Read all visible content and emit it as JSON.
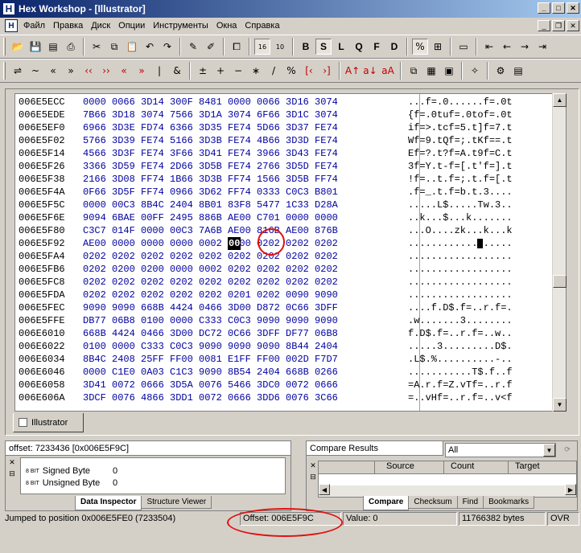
{
  "window": {
    "title": "Hex Workshop - [Illustrator]"
  },
  "menu": [
    "Файл",
    "Правка",
    "Диск",
    "Опции",
    "Инструменты",
    "Окна",
    "Справка"
  ],
  "toolbar1": {
    "mode_labels": [
      "B",
      "S",
      "L",
      "Q",
      "F",
      "D"
    ]
  },
  "hex_rows": [
    {
      "addr": "006E5ECC",
      "hex": "0000 0066 3D14 300F 8481 0000 0066 3D16 3074",
      "ascii": "...f=.0......f=.0t"
    },
    {
      "addr": "006E5EDE",
      "hex": "7B66 3D18 3074 7566 3D1A 3074 6F66 3D1C 3074",
      "ascii": "{f=.0tuf=.0tof=.0t"
    },
    {
      "addr": "006E5EF0",
      "hex": "6966 3D3E FD74 6366 3D35 FE74 5D66 3D37 FE74",
      "ascii": "if=>.tcf=5.t]f=7.t"
    },
    {
      "addr": "006E5F02",
      "hex": "5766 3D39 FE74 5166 3D3B FE74 4B66 3D3D FE74",
      "ascii": "Wf=9.tQf=;.tKf==.t"
    },
    {
      "addr": "006E5F14",
      "hex": "4566 3D3F FE74 3F66 3D41 FE74 3966 3D43 FE74",
      "ascii": "Ef=?.t?f=A.t9f=C.t"
    },
    {
      "addr": "006E5F26",
      "hex": "3366 3D59 FE74 2D66 3D5B FE74 2766 3D5D FE74",
      "ascii": "3f=Y.t-f=[.t'f=].t"
    },
    {
      "addr": "006E5F38",
      "hex": "2166 3D08 FF74 1B66 3D3B FF74 1566 3D5B FF74",
      "ascii": "!f=..t.f=;.t.f=[.t"
    },
    {
      "addr": "006E5F4A",
      "hex": "0F66 3D5F FF74 0966 3D62 FF74 0333 C0C3 B801",
      "ascii": ".f=_.t.f=b.t.3...."
    },
    {
      "addr": "006E5F5C",
      "hex": "0000 00C3 8B4C 2404 8B01 83F8 5477 1C33 D28A",
      "ascii": ".....L$.....Tw.3.."
    },
    {
      "addr": "006E5F6E",
      "hex": "9094 6BAE 00FF 2495 886B AE00 C701 0000 0000",
      "ascii": "..k...$...k......."
    },
    {
      "addr": "006E5F80",
      "hex": "C3C7 014F 0000 00C3 7A6B AE00 816B AE00 876B",
      "ascii": "...O....zk...k...k"
    },
    {
      "addr": "006E5F92",
      "hex": "AE00 0000 0000 0000 0002 0000 0202 0202 0202",
      "ascii": ".................."
    },
    {
      "addr": "006E5FA4",
      "hex": "0202 0202 0202 0202 0202 0202 0202 0202 0202",
      "ascii": ".................."
    },
    {
      "addr": "006E5FB6",
      "hex": "0202 0200 0200 0000 0002 0202 0202 0202 0202",
      "ascii": ".................."
    },
    {
      "addr": "006E5FC8",
      "hex": "0202 0202 0202 0202 0202 0202 0202 0202 0202",
      "ascii": ".................."
    },
    {
      "addr": "006E5FDA",
      "hex": "0202 0202 0202 0202 0202 0201 0202 0090 9090",
      "ascii": ".................."
    },
    {
      "addr": "006E5FEC",
      "hex": "9090 9090 668B 4424 0466 3D00 D872 0C66 3DFF",
      "ascii": "....f.D$.f=..r.f=."
    },
    {
      "addr": "006E5FFE",
      "hex": "DB77 06B8 0100 0000 C333 C0C3 9090 9090 9090",
      "ascii": ".w.......3........"
    },
    {
      "addr": "006E6010",
      "hex": "668B 4424 0466 3D00 DC72 0C66 3DFF DF77 06B8",
      "ascii": "f.D$.f=..r.f=..w.."
    },
    {
      "addr": "006E6022",
      "hex": "0100 0000 C333 C0C3 9090 9090 9090 8B44 2404",
      "ascii": ".....3.........D$."
    },
    {
      "addr": "006E6034",
      "hex": "8B4C 2408 25FF FF00 0081 E1FF FF00 002D F7D7",
      "ascii": ".L$.%..........-.."
    },
    {
      "addr": "006E6046",
      "hex": "0000 C1E0 0A03 C1C3 9090 8B54 2404 668B 0266",
      "ascii": "...........T$.f..f"
    },
    {
      "addr": "006E6058",
      "hex": "3D41 0072 0666 3D5A 0076 5466 3DC0 0072 0666",
      "ascii": "=A.r.f=Z.vTf=..r.f"
    },
    {
      "addr": "006E606A",
      "hex": "3DCF 0076 4866 3DD1 0072 0666 3DD6 0076 3C66",
      "ascii": "=..vHf=..r.f=..v<f"
    }
  ],
  "document_tab": "Illustrator",
  "inspector": {
    "title": "offset: 7233436 [0x006E5F9C]",
    "rows": [
      {
        "type": "Signed Byte",
        "value": "0"
      },
      {
        "type": "Unsigned Byte",
        "value": "0"
      }
    ],
    "tabs": [
      "Data Inspector",
      "Structure Viewer"
    ],
    "type_prefix": "8 BIT"
  },
  "compare": {
    "title": "Compare Results",
    "filter": "All",
    "columns": [
      "Source",
      "Count",
      "Target"
    ],
    "tabs": [
      "Compare",
      "Checksum",
      "Find",
      "Bookmarks"
    ]
  },
  "status": {
    "message": "Jumped to position 0x006E5FE0 (7233504)",
    "offset": "Offset: 006E5F9C",
    "value": "Value: 0",
    "size": "11766382 bytes",
    "mode": "OVR"
  },
  "cursor_byte": "00",
  "colors": {
    "title_start": "#0a246a",
    "title_end": "#a6caf0",
    "hex_text": "#0000a0",
    "annotation": "#e01010"
  }
}
